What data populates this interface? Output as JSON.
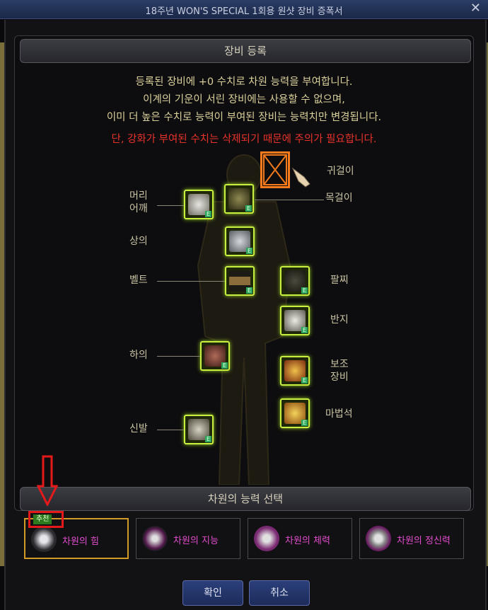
{
  "window": {
    "title": "18주년 WON'S SPECIAL 1회용 원샷 장비 증폭서",
    "close_glyph": "✕"
  },
  "register": {
    "header": "장비 등록",
    "lines": [
      "등록된 장비에 +0 수치로 차원 능력을 부여합니다.",
      "이계의 기운이 서린 장비에는 사용할 수 없으며,",
      "이미 더 높은 수치로 능력이 부여된 장비는 능력치만 변경됩니다."
    ],
    "warning": "단, 강화가 부여된 수치는 삭제되기 때문에 주의가 필요합니다."
  },
  "slots": {
    "earring": "귀걸이",
    "head_shoulder": "머리\n어깨",
    "necklace": "목걸이",
    "top": "상의",
    "belt": "벨트",
    "bracelet": "팔찌",
    "ring": "반지",
    "bottom": "하의",
    "sub_equip": "보조\n장비",
    "magic_stone": "마법석",
    "shoes": "신발",
    "enhanced_badge": "E"
  },
  "abilities": {
    "header": "차원의 능력 선택",
    "recommend_badge": "추천",
    "items": [
      {
        "label": "차원의 힘"
      },
      {
        "label": "차원의 지능"
      },
      {
        "label": "차원의 체력"
      },
      {
        "label": "차원의 정신력"
      }
    ],
    "selected_index": 0
  },
  "buttons": {
    "confirm": "확인",
    "cancel": "취소"
  },
  "colors": {
    "accent": "#d39a25",
    "warning": "#e8322a",
    "slot_glow": "#c8f040",
    "annotation": "#e41a1a",
    "marker": "#f47a1c"
  }
}
